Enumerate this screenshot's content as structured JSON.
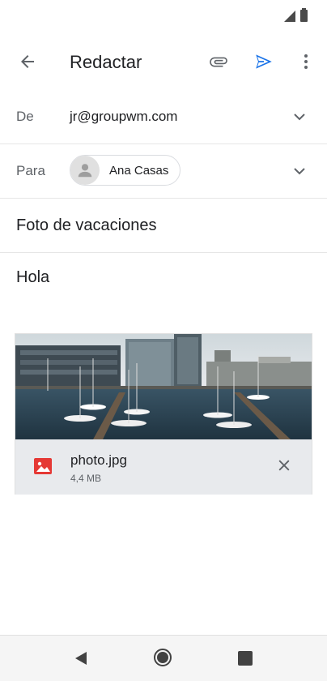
{
  "header": {
    "title": "Redactar"
  },
  "from": {
    "label": "De",
    "value": "jr@groupwm.com"
  },
  "to": {
    "label": "Para",
    "recipient": "Ana Casas"
  },
  "subject": "Foto de vacaciones",
  "body": "Hola",
  "attachment": {
    "file_name": "photo.jpg",
    "file_size": "4,4 MB"
  },
  "colors": {
    "accent": "#1a73e8",
    "image_icon": "#e53935"
  },
  "icons": {
    "back": "arrow-left-icon",
    "attach": "paperclip-icon",
    "send": "send-icon",
    "more": "more-vert-icon",
    "chevron": "chevron-down-icon",
    "avatar": "person-icon",
    "image": "image-icon",
    "remove": "close-icon"
  }
}
